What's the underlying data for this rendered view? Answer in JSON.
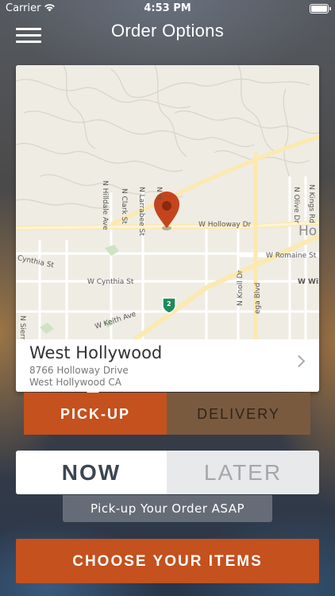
{
  "status_bar": {
    "carrier": "Carrier",
    "time": "4:53 PM"
  },
  "nav": {
    "title": "Order Options"
  },
  "map": {
    "labels": {
      "holloway": "W Holloway Dr",
      "romaine": "W Romaine St",
      "cynthia_w": "W Cynthia St",
      "cynthia": "Cynthia St",
      "keith": "W Keith Ave",
      "hilldale": "N Hilldale Ave",
      "clark": "N Clark St",
      "larrabee": "N Larrabee St",
      "n_h": "N H",
      "knoll": "N Knoll Dr",
      "olive": "N Olive Dr",
      "kings": "N Kings Rd",
      "sierra": "N Sierra",
      "willoughby": "W Wil",
      "ega": "ega Blvd",
      "town": "Ho",
      "route": "2"
    }
  },
  "location": {
    "name": "West Hollywood",
    "address_line1": "8766 Holloway Drive",
    "address_line2": "West Hollywood CA"
  },
  "tabs": {
    "pickup": "PICK-UP",
    "delivery": "DELIVERY"
  },
  "timing": {
    "now": "NOW",
    "later": "LATER",
    "note": "Pick-up Your Order ASAP"
  },
  "cta": {
    "label": "CHOOSE YOUR ITEMS"
  },
  "colors": {
    "accent": "#c4511e",
    "delivery_tab": "#7a5a3e",
    "pin": "#c4451c"
  }
}
